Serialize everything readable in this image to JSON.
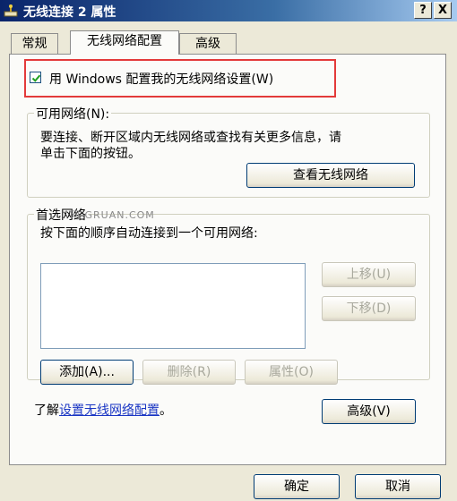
{
  "window": {
    "title": "无线连接 2 属性",
    "help_button": "?",
    "close_button": "X"
  },
  "tabs": [
    {
      "label": "常规",
      "active": false
    },
    {
      "label": "无线网络配置",
      "active": true
    },
    {
      "label": "高级",
      "active": false
    }
  ],
  "windows_config": {
    "checkbox_checked": true,
    "label": "用 Windows 配置我的无线网络设置(W)"
  },
  "available_networks": {
    "legend": "可用网络(N):",
    "description_line1": "要连接、断开区域内无线网络或查找有关更多信息，请",
    "description_line2": "单击下面的按钮。",
    "view_button": "查看无线网络"
  },
  "preferred_networks": {
    "legend": "首选网络",
    "instruction": "按下面的顺序自动连接到一个可用网络:",
    "move_up_button": "上移(U)",
    "move_down_button": "下移(D)",
    "add_button": "添加(A)...",
    "remove_button": "删除(R)",
    "properties_button": "属性(O)"
  },
  "learn_more": {
    "prefix": "了解",
    "link": "设置无线网络配置",
    "suffix": "。",
    "advanced_button": "高级(V)"
  },
  "footer": {
    "ok_button": "确定",
    "cancel_button": "取消"
  },
  "watermark": "网 GRUAN.COM",
  "colors": {
    "titlebar_start": "#0a246a",
    "titlebar_end": "#a6caf0",
    "highlight_border": "#e33a3a",
    "link": "#1a36c4"
  }
}
